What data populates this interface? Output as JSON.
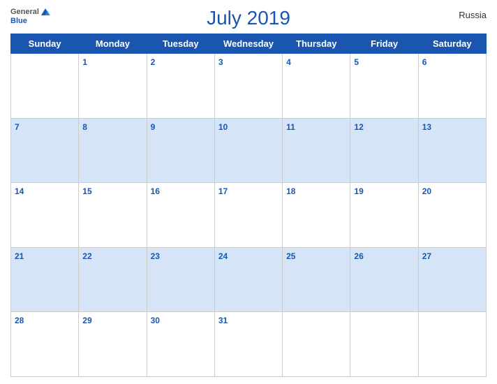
{
  "header": {
    "title": "July 2019",
    "country": "Russia",
    "logo": {
      "general": "General",
      "blue": "Blue"
    }
  },
  "days_of_week": [
    "Sunday",
    "Monday",
    "Tuesday",
    "Wednesday",
    "Thursday",
    "Friday",
    "Saturday"
  ],
  "weeks": [
    [
      "",
      "1",
      "2",
      "3",
      "4",
      "5",
      "6"
    ],
    [
      "7",
      "8",
      "9",
      "10",
      "11",
      "12",
      "13"
    ],
    [
      "14",
      "15",
      "16",
      "17",
      "18",
      "19",
      "20"
    ],
    [
      "21",
      "22",
      "23",
      "24",
      "25",
      "26",
      "27"
    ],
    [
      "28",
      "29",
      "30",
      "31",
      "",
      "",
      ""
    ]
  ],
  "row_shading": [
    false,
    true,
    false,
    true,
    false
  ]
}
